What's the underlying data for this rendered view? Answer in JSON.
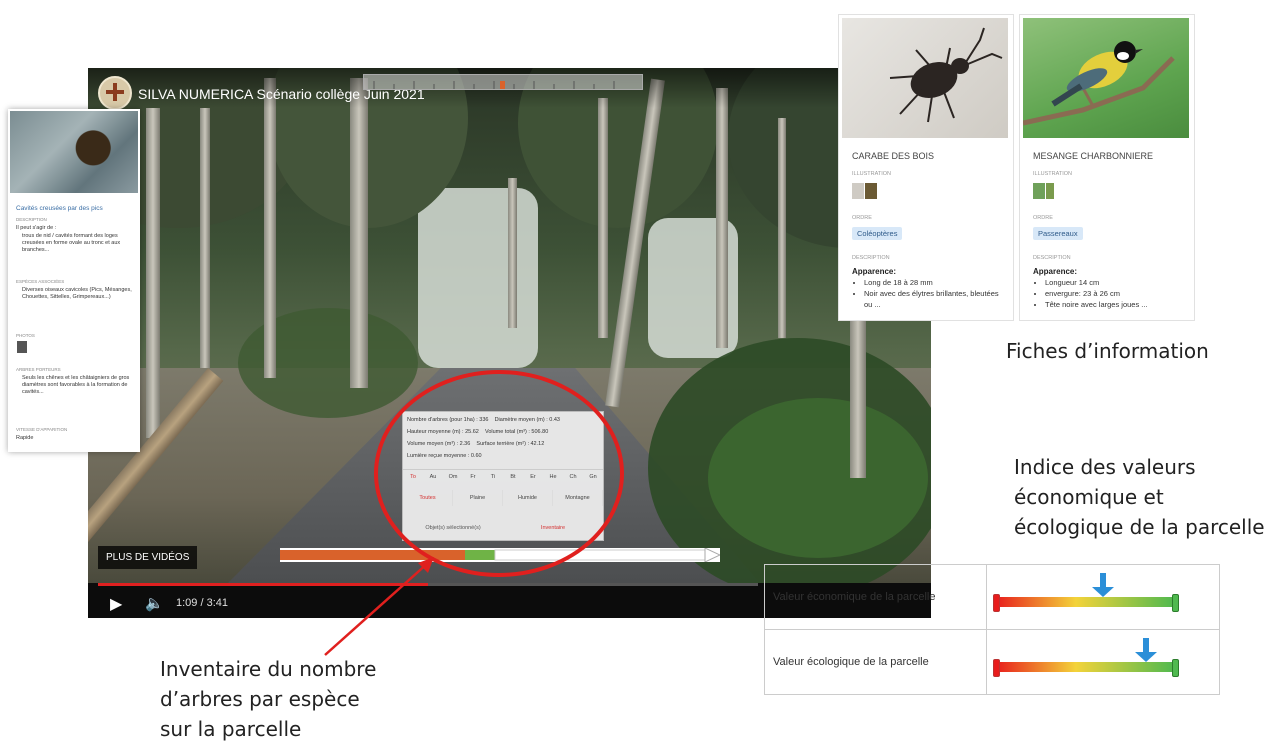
{
  "video": {
    "title": "SILVA NUMERICA Scénario collège Juin 2021",
    "more_videos": "PLUS DE VIDÉOS",
    "time": "1:09 / 3:41",
    "progress_fraction": 0.5,
    "colors": {
      "scrub": "#e02020",
      "progress_bar_red": "#d9622b",
      "progress_bar_green": "#6fb346"
    }
  },
  "inventory": {
    "rows": [
      [
        "Nombre d'arbres (pour 1ha) : 336",
        "Diamètre moyen (m) : 0.43"
      ],
      [
        "Hauteur moyenne (m) : 25.62",
        "Volume total (m³) : 506.80"
      ],
      [
        "Volume moyen (m³) : 2.36",
        "Surface terrière (m²) : 42.12"
      ],
      [
        "Lumière reçue moyenne : 0.60",
        ""
      ]
    ],
    "species_tabs": [
      "To",
      "Au",
      "Om",
      "Fr",
      "Ti",
      "Bt",
      "Er",
      "He",
      "Ch",
      "Gn"
    ],
    "zones": [
      "Toutes",
      "Plaine",
      "Humide",
      "Montagne"
    ],
    "bottom_tabs": [
      "Objet(s) sélectionné(s)",
      "Inventaire"
    ]
  },
  "left_card": {
    "title": "Cavités creusées par des pics",
    "sections": [
      {
        "label": "Description",
        "text": "Il peut s'agir de :"
      },
      {
        "label": "",
        "text": "trous de nid / cavités formant des loges creusées en forme ovale au tronc et aux branches..."
      },
      {
        "label": "Espèces associées",
        "text": "Diverses oiseaux cavicoles (Pics, Mésanges, Chouettes, Sittelles, Grimpereaux...)"
      },
      {
        "label": "Photos",
        "text": ""
      },
      {
        "label": "Arbres porteurs",
        "text": "Seuls les chênes et les châtaigniers de gros diamètres sont favorables à la formation de cavités..."
      },
      {
        "label": "Vitesse d'apparition",
        "text": "Rapide"
      }
    ]
  },
  "species_cards": [
    {
      "name": "CARABE DES BOIS",
      "illustration_label": "ILLUSTRATION",
      "order_label": "ORDRE",
      "order": "Coléoptères",
      "description_label": "DESCRIPTION",
      "appearance": "Apparence:",
      "bullets": [
        "Long de 18 à 28 mm",
        "Noir avec des élytres brillantes, bleutées ou ..."
      ],
      "photo_icon": "beetle-photo"
    },
    {
      "name": "MESANGE CHARBONNIERE",
      "illustration_label": "ILLUSTRATION",
      "order_label": "ORDRE",
      "order": "Passereaux",
      "description_label": "DESCRIPTION",
      "appearance": "Apparence:",
      "bullets": [
        "Longueur 14 cm",
        "envergure: 23 à 26 cm",
        "Tête noire avec larges joues ..."
      ],
      "photo_icon": "bird-photo"
    }
  ],
  "annotations": {
    "fiches": "Fiches d’information",
    "indice": [
      "Indice des valeurs",
      "économique et",
      "écologique de la parcelle"
    ],
    "inventaire": [
      "Inventaire du nombre",
      "d’arbres par espèce",
      "sur la parcelle"
    ]
  },
  "value_table": {
    "rows": [
      {
        "label": "Valeur économique de la parcelle",
        "level": 0.6
      },
      {
        "label": "Valeur écologique de la parcelle",
        "level": 0.84
      }
    ],
    "colors": {
      "low": "#e81c1c",
      "mid": "#f3d33a",
      "high": "#4fb94f",
      "arrow": "#2b8fd8"
    }
  }
}
